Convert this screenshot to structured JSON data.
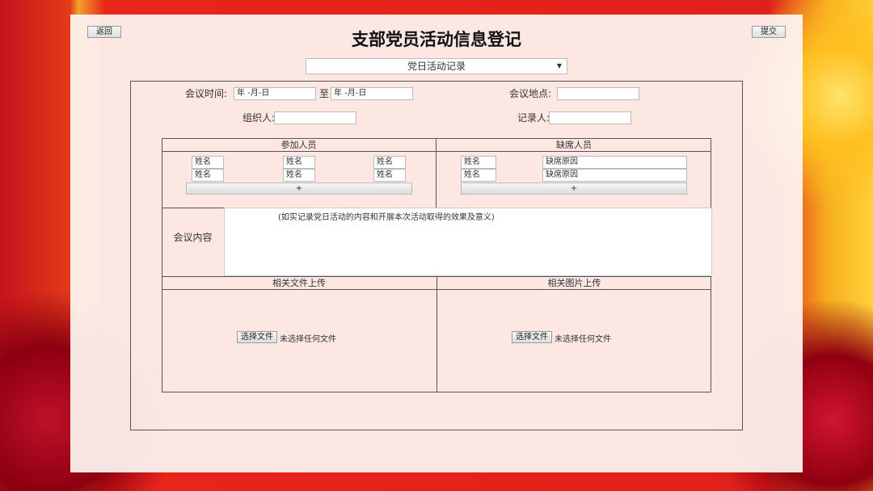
{
  "header": {
    "back_label": "返回",
    "title": "支部党员活动信息登记",
    "submit_label": "提交"
  },
  "type_select": {
    "value": "党日活动记录"
  },
  "form": {
    "meeting_time_label": "会议时间:",
    "date_start_placeholder": "年 -月-日",
    "to_label": "至",
    "date_end_placeholder": "年 -月-日",
    "location_label": "会议地点:",
    "organizer_label": "组织人:",
    "recorder_label": "记录人:"
  },
  "attendees": {
    "header": "参加人员",
    "name_placeholder": "姓名",
    "add_label": "+"
  },
  "absentees": {
    "header": "缺席人员",
    "name_placeholder": "姓名",
    "reason_placeholder": "缺席原因",
    "add_label": "+"
  },
  "content": {
    "label": "会议内容",
    "placeholder": "(如实记录党日活动的内容和开展本次活动取得的效果及意义)"
  },
  "uploads": {
    "files_header": "相关文件上传",
    "images_header": "相关图片上传",
    "choose_label": "选择文件",
    "no_file_text": "未选择任何文件"
  }
}
